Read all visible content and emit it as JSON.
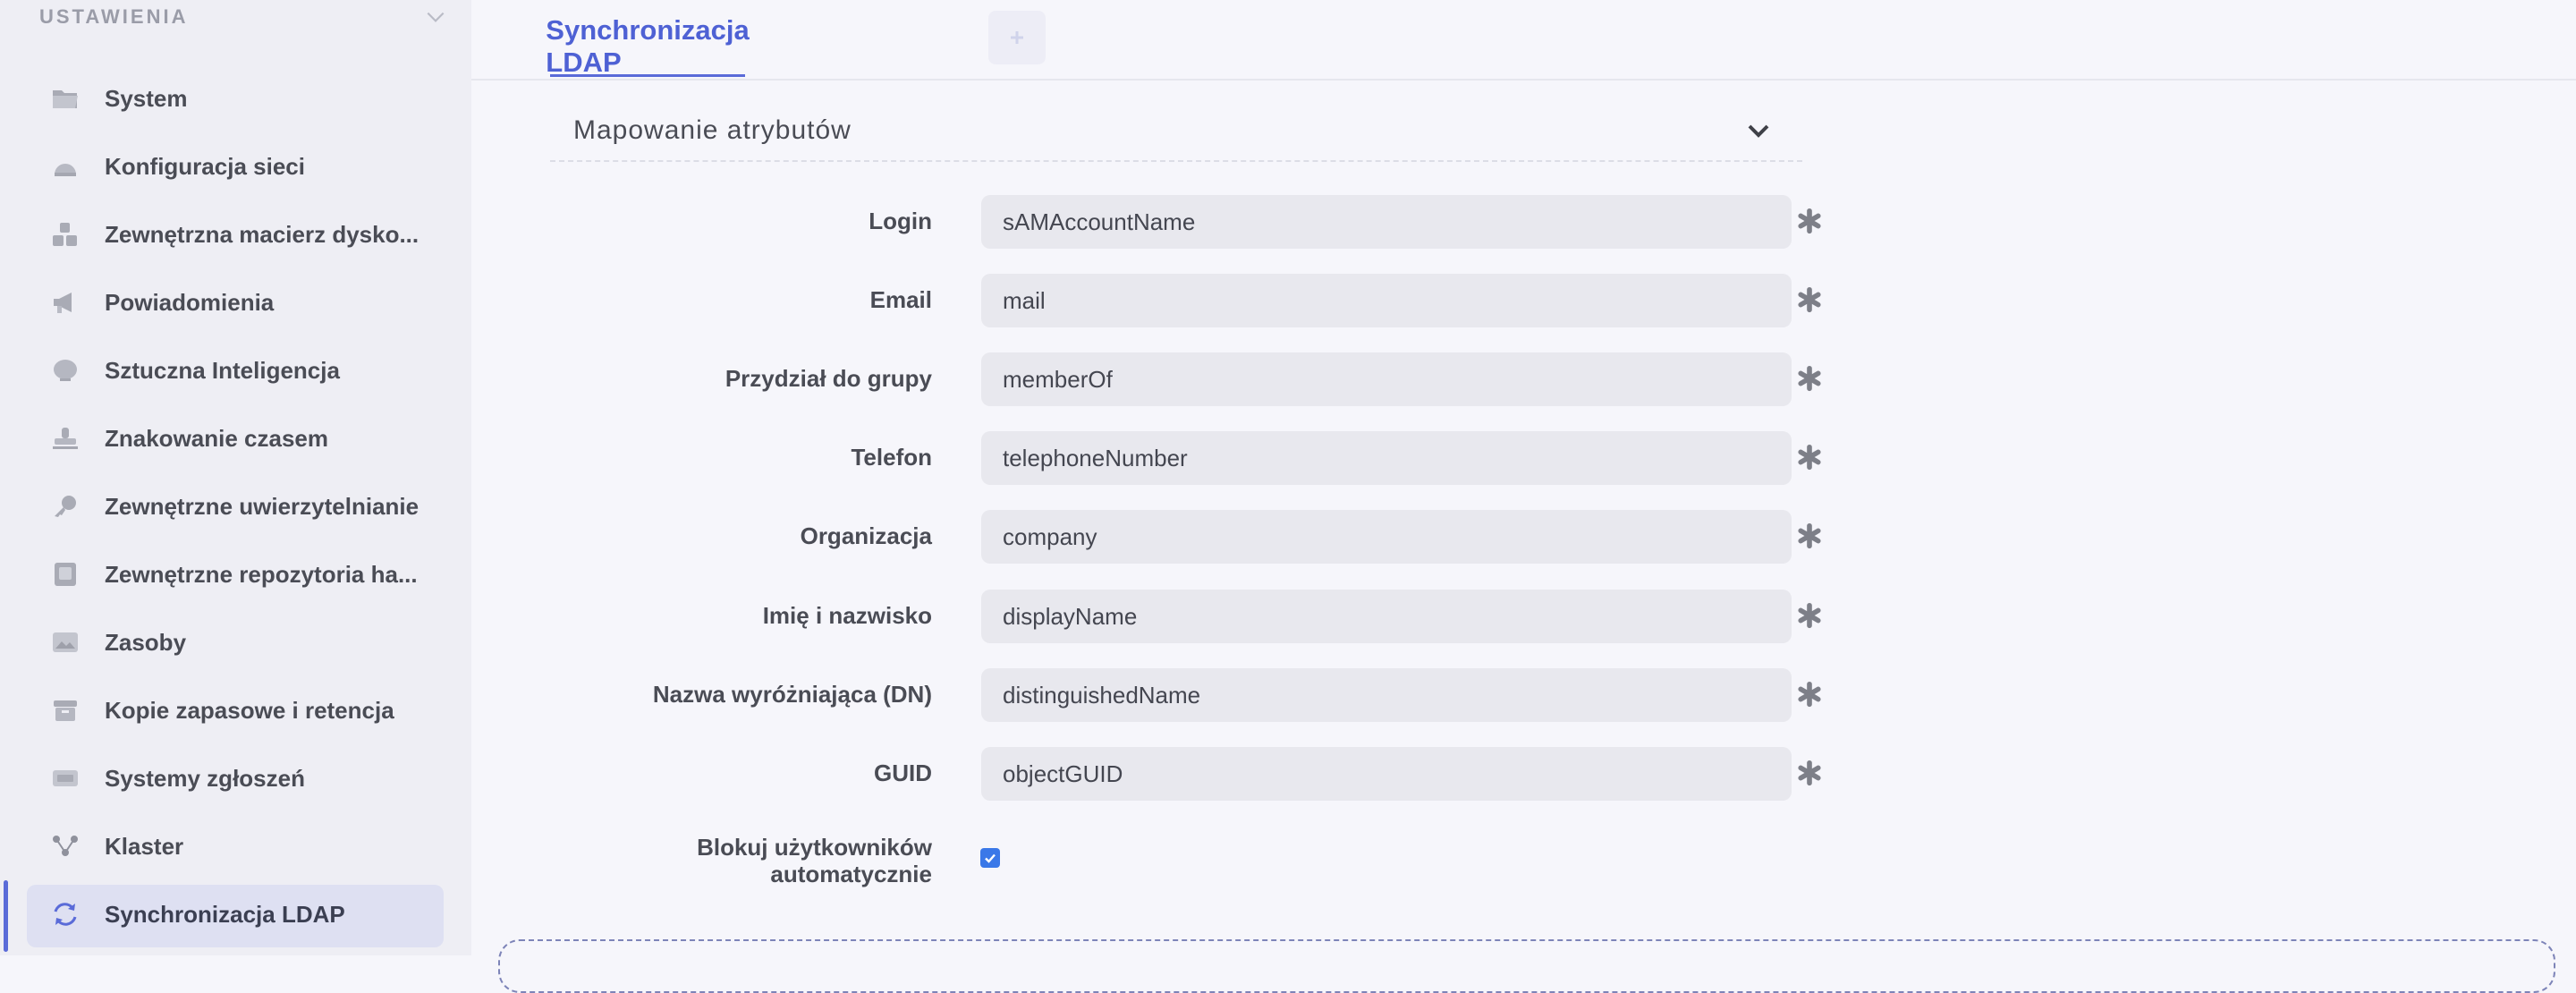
{
  "sidebar": {
    "header": "USTAWIENIA",
    "items": [
      {
        "label": "System",
        "icon": "folder-icon"
      },
      {
        "label": "Konfiguracja sieci",
        "icon": "network-icon"
      },
      {
        "label": "Zewnętrzna macierz dysko...",
        "icon": "disk-array-icon"
      },
      {
        "label": "Powiadomienia",
        "icon": "megaphone-icon"
      },
      {
        "label": "Sztuczna Inteligencja",
        "icon": "brain-icon"
      },
      {
        "label": "Znakowanie czasem",
        "icon": "stamp-icon"
      },
      {
        "label": "Zewnętrzne uwierzytelnianie",
        "icon": "key-icon"
      },
      {
        "label": "Zewnętrzne repozytoria ha...",
        "icon": "vault-icon"
      },
      {
        "label": "Zasoby",
        "icon": "image-icon"
      },
      {
        "label": "Kopie zapasowe i retencja",
        "icon": "archive-icon"
      },
      {
        "label": "Systemy zgłoszeń",
        "icon": "ticket-icon"
      },
      {
        "label": "Klaster",
        "icon": "cluster-icon"
      },
      {
        "label": "Synchronizacja LDAP",
        "icon": "sync-icon",
        "active": true
      }
    ]
  },
  "tabs": {
    "active_label": "Synchronizacja LDAP"
  },
  "section": {
    "title": "Mapowanie atrybutów"
  },
  "fields": [
    {
      "label": "Login",
      "value": "sAMAccountName"
    },
    {
      "label": "Email",
      "value": "mail"
    },
    {
      "label": "Przydział do grupy",
      "value": "memberOf"
    },
    {
      "label": "Telefon",
      "value": "telephoneNumber"
    },
    {
      "label": "Organizacja",
      "value": "company"
    },
    {
      "label": "Imię i nazwisko",
      "value": "displayName"
    },
    {
      "label": "Nazwa wyróżniająca (DN)",
      "value": "distinguishedName"
    },
    {
      "label": "GUID",
      "value": "objectGUID"
    }
  ],
  "block_users": {
    "label_line1": "Blokuj użytkowników",
    "label_line2": "automatycznie",
    "checked": true
  },
  "colors": {
    "accent": "#5a6bd8",
    "checkbox": "#3a78e8",
    "input_bg": "#e8e8ee"
  }
}
